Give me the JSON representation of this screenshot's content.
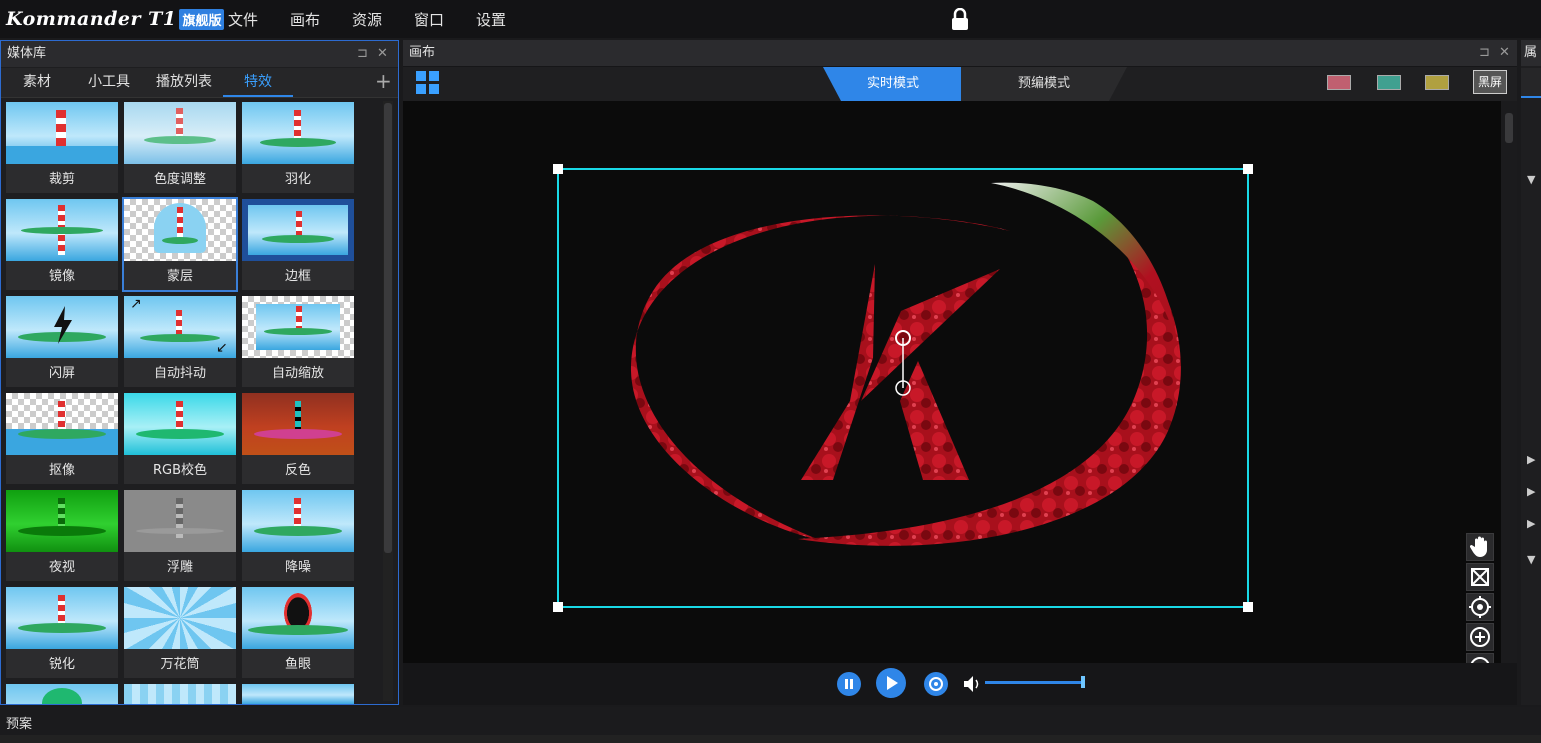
{
  "app": {
    "logo_text": "Kommander T1",
    "edition": "旗舰版"
  },
  "menu": [
    "文件",
    "画布",
    "资源",
    "窗口",
    "设置"
  ],
  "media_library": {
    "title": "媒体库",
    "pin_glyph": "⊐",
    "close_glyph": "✕",
    "add_glyph": "+",
    "tabs": [
      "素材",
      "小工具",
      "播放列表",
      "特效"
    ],
    "active_tab": "特效",
    "effects": [
      "裁剪",
      "色度调整",
      "羽化",
      "镜像",
      "蒙层",
      "边框",
      "闪屏",
      "自动抖动",
      "自动缩放",
      "抠像",
      "RGB校色",
      "反色",
      "夜视",
      "浮雕",
      "降噪",
      "锐化",
      "万花筒",
      "鱼眼"
    ],
    "selected": "蒙层"
  },
  "canvas": {
    "title": "画布",
    "pin_glyph": "⊐",
    "close_glyph": "✕",
    "modes": {
      "live": "实时模式",
      "preedit": "预编模式"
    },
    "black_screen": "黑屏",
    "swatches": [
      "#c06070",
      "#40a090",
      "#b0a040"
    ]
  },
  "right_panel": {
    "title": "属"
  },
  "bottom": {
    "title": "预案"
  },
  "accent": "#2f86e8"
}
